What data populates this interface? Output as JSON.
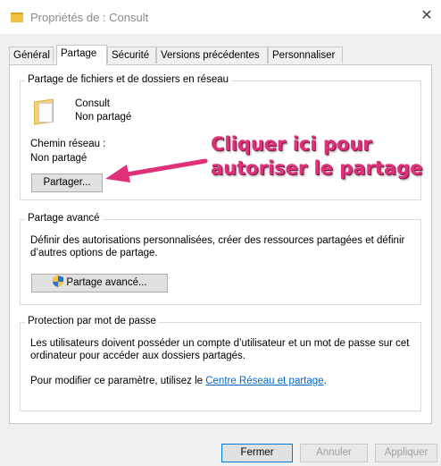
{
  "window": {
    "title": "Propriétés de : Consult",
    "close_glyph": "✕"
  },
  "tabs": [
    {
      "label": "Général"
    },
    {
      "label": "Partage"
    },
    {
      "label": "Sécurité"
    },
    {
      "label": "Versions précédentes"
    },
    {
      "label": "Personnaliser"
    }
  ],
  "network_sharing": {
    "title": "Partage de fichiers et de dossiers en réseau",
    "folder_name": "Consult",
    "status": "Non partagé",
    "path_label": "Chemin réseau :",
    "path_value": "Non partagé",
    "share_button": "Partager..."
  },
  "annotation": {
    "line1": "Cliquer ici pour",
    "line2": "autoriser le partage",
    "color": "#e0307a"
  },
  "advanced_sharing": {
    "title": "Partage avancé",
    "description": "Définir des autorisations personnalisées, créer des ressources partagées et définir d’autres options de partage.",
    "button": "Partage avancé..."
  },
  "password_protection": {
    "title": "Protection par mot de passe",
    "description": "Les utilisateurs doivent posséder un compte d’utilisateur et un mot de passe sur cet ordinateur pour accéder aux dossiers partagés.",
    "modify_prefix": "Pour modifier ce paramètre, utilisez le ",
    "link": "Centre Réseau et partage",
    "modify_suffix": "."
  },
  "footer": {
    "close": "Fermer",
    "cancel": "Annuler",
    "apply": "Appliquer"
  }
}
